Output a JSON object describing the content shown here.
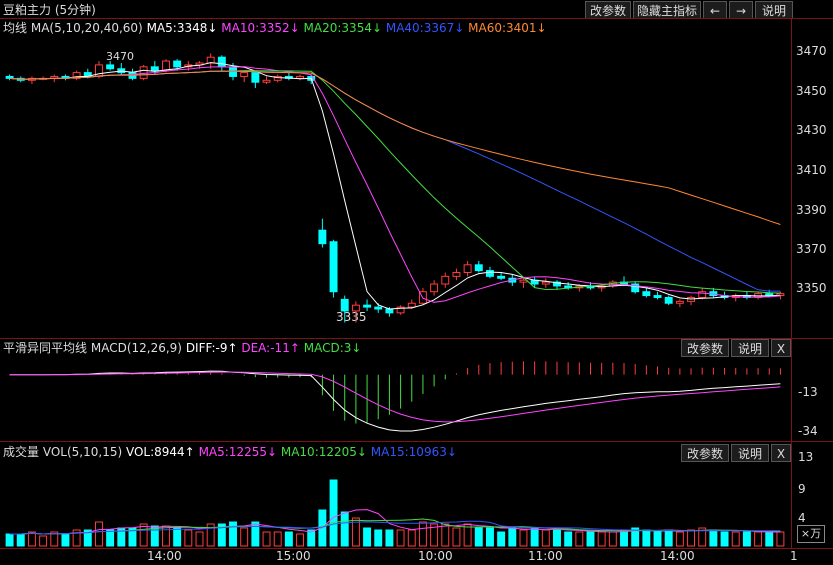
{
  "header": {
    "instrument": "豆粕主力 (5分钟)",
    "buttons": [
      "改参数",
      "隐藏主指标",
      "←",
      "→",
      "说明"
    ]
  },
  "main_panel": {
    "indicator_name": "均线",
    "params": "MA(5,10,20,40,60)",
    "ma5": "MA5:3348↓",
    "ma10": "MA10:3352↓",
    "ma20": "MA20:3354↓",
    "ma40": "MA40:3367↓",
    "ma60": "MA60:3401↓",
    "y_ticks": [
      "3470",
      "3450",
      "3430",
      "3410",
      "3390",
      "3370",
      "3350"
    ],
    "annotations": [
      "3470",
      "3335"
    ]
  },
  "macd_panel": {
    "title": "平滑异同平均线",
    "params": "MACD(12,26,9)",
    "diff": "DIFF:-9↑",
    "dea": "DEA:-11↑",
    "macd": "MACD:3↓",
    "buttons": [
      "改参数",
      "说明",
      "X"
    ],
    "y_ticks": [
      "-13",
      "-34"
    ]
  },
  "vol_panel": {
    "title": "成交量",
    "params": "VOL(5,10,15)",
    "vol": "VOL:8944↑",
    "ma5": "MA5:12255↓",
    "ma10": "MA10:12205↓",
    "ma15": "MA15:10963↓",
    "buttons": [
      "改参数",
      "说明",
      "X"
    ],
    "y_ticks": [
      "13",
      "9",
      "4"
    ],
    "unit": "×万"
  },
  "x_axis": {
    "labels": [
      "14:00",
      "15:00",
      "10:00",
      "11:00",
      "14:00",
      "1"
    ]
  },
  "colors": {
    "up": "#ff3c3c",
    "down": "#00ffff",
    "ma5": "#ffffff",
    "ma10": "#ff44ff",
    "ma20": "#44dd44",
    "ma40": "#3355ff",
    "ma60": "#ff8833",
    "frame": "#7a1414"
  },
  "chart_data": {
    "type": "candlestick",
    "ylim": [
      3328,
      3482
    ],
    "candles": [
      [
        3462,
        3463,
        3460,
        3461
      ],
      [
        3461,
        3462,
        3459,
        3460
      ],
      [
        3460,
        3462,
        3458,
        3461
      ],
      [
        3461,
        3462,
        3460,
        3461
      ],
      [
        3461,
        3463,
        3459,
        3462
      ],
      [
        3462,
        3463,
        3460,
        3461
      ],
      [
        3461,
        3465,
        3460,
        3464
      ],
      [
        3464,
        3466,
        3461,
        3462
      ],
      [
        3462,
        3470,
        3461,
        3468
      ],
      [
        3468,
        3470,
        3465,
        3466
      ],
      [
        3466,
        3469,
        3463,
        3464
      ],
      [
        3464,
        3466,
        3460,
        3461
      ],
      [
        3461,
        3468,
        3460,
        3467
      ],
      [
        3467,
        3470,
        3463,
        3465
      ],
      [
        3465,
        3471,
        3464,
        3470
      ],
      [
        3470,
        3471,
        3465,
        3467
      ],
      [
        3467,
        3470,
        3465,
        3468
      ],
      [
        3468,
        3470,
        3466,
        3469
      ],
      [
        3469,
        3474,
        3466,
        3472
      ],
      [
        3472,
        3473,
        3465,
        3467
      ],
      [
        3467,
        3469,
        3460,
        3462
      ],
      [
        3462,
        3465,
        3459,
        3464
      ],
      [
        3464,
        3465,
        3456,
        3459
      ],
      [
        3459,
        3462,
        3458,
        3460
      ],
      [
        3460,
        3463,
        3459,
        3462
      ],
      [
        3462,
        3464,
        3460,
        3461
      ],
      [
        3461,
        3463,
        3460,
        3462
      ],
      [
        3462,
        3463,
        3458,
        3460
      ],
      [
        3382,
        3388,
        3373,
        3375
      ],
      [
        3376,
        3377,
        3347,
        3350
      ],
      [
        3346,
        3348,
        3334,
        3340
      ],
      [
        3340,
        3345,
        3334,
        3343
      ],
      [
        3343,
        3346,
        3340,
        3342
      ],
      [
        3342,
        3344,
        3339,
        3341
      ],
      [
        3341,
        3342,
        3337,
        3339
      ],
      [
        3339,
        3343,
        3338,
        3342
      ],
      [
        3342,
        3346,
        3341,
        3344
      ],
      [
        3344,
        3352,
        3343,
        3350
      ],
      [
        3350,
        3356,
        3348,
        3354
      ],
      [
        3354,
        3360,
        3352,
        3358
      ],
      [
        3358,
        3362,
        3356,
        3360
      ],
      [
        3360,
        3366,
        3358,
        3364
      ],
      [
        3364,
        3366,
        3360,
        3361
      ],
      [
        3361,
        3363,
        3357,
        3358
      ],
      [
        3358,
        3360,
        3356,
        3357
      ],
      [
        3357,
        3359,
        3353,
        3355
      ],
      [
        3355,
        3357,
        3352,
        3356
      ],
      [
        3356,
        3358,
        3352,
        3354
      ],
      [
        3354,
        3357,
        3352,
        3355
      ],
      [
        3355,
        3356,
        3351,
        3353
      ],
      [
        3353,
        3355,
        3351,
        3352
      ],
      [
        3352,
        3354,
        3350,
        3353
      ],
      [
        3353,
        3355,
        3351,
        3352
      ],
      [
        3352,
        3354,
        3350,
        3353
      ],
      [
        3353,
        3356,
        3352,
        3355
      ],
      [
        3355,
        3358,
        3353,
        3354
      ],
      [
        3354,
        3355,
        3349,
        3350
      ],
      [
        3350,
        3352,
        3347,
        3348
      ],
      [
        3348,
        3350,
        3346,
        3347
      ],
      [
        3347,
        3348,
        3343,
        3344
      ],
      [
        3344,
        3346,
        3342,
        3345
      ],
      [
        3345,
        3348,
        3343,
        3347
      ],
      [
        3347,
        3352,
        3346,
        3350
      ],
      [
        3350,
        3352,
        3347,
        3348
      ],
      [
        3348,
        3350,
        3346,
        3347
      ],
      [
        3347,
        3349,
        3345,
        3348
      ],
      [
        3348,
        3350,
        3346,
        3347
      ],
      [
        3347,
        3350,
        3346,
        3349
      ],
      [
        3349,
        3351,
        3347,
        3348
      ],
      [
        3348,
        3350,
        3346,
        3349
      ]
    ],
    "macd_ylim": [
      -38,
      10
    ],
    "vol_ylim": [
      0,
      14
    ]
  }
}
